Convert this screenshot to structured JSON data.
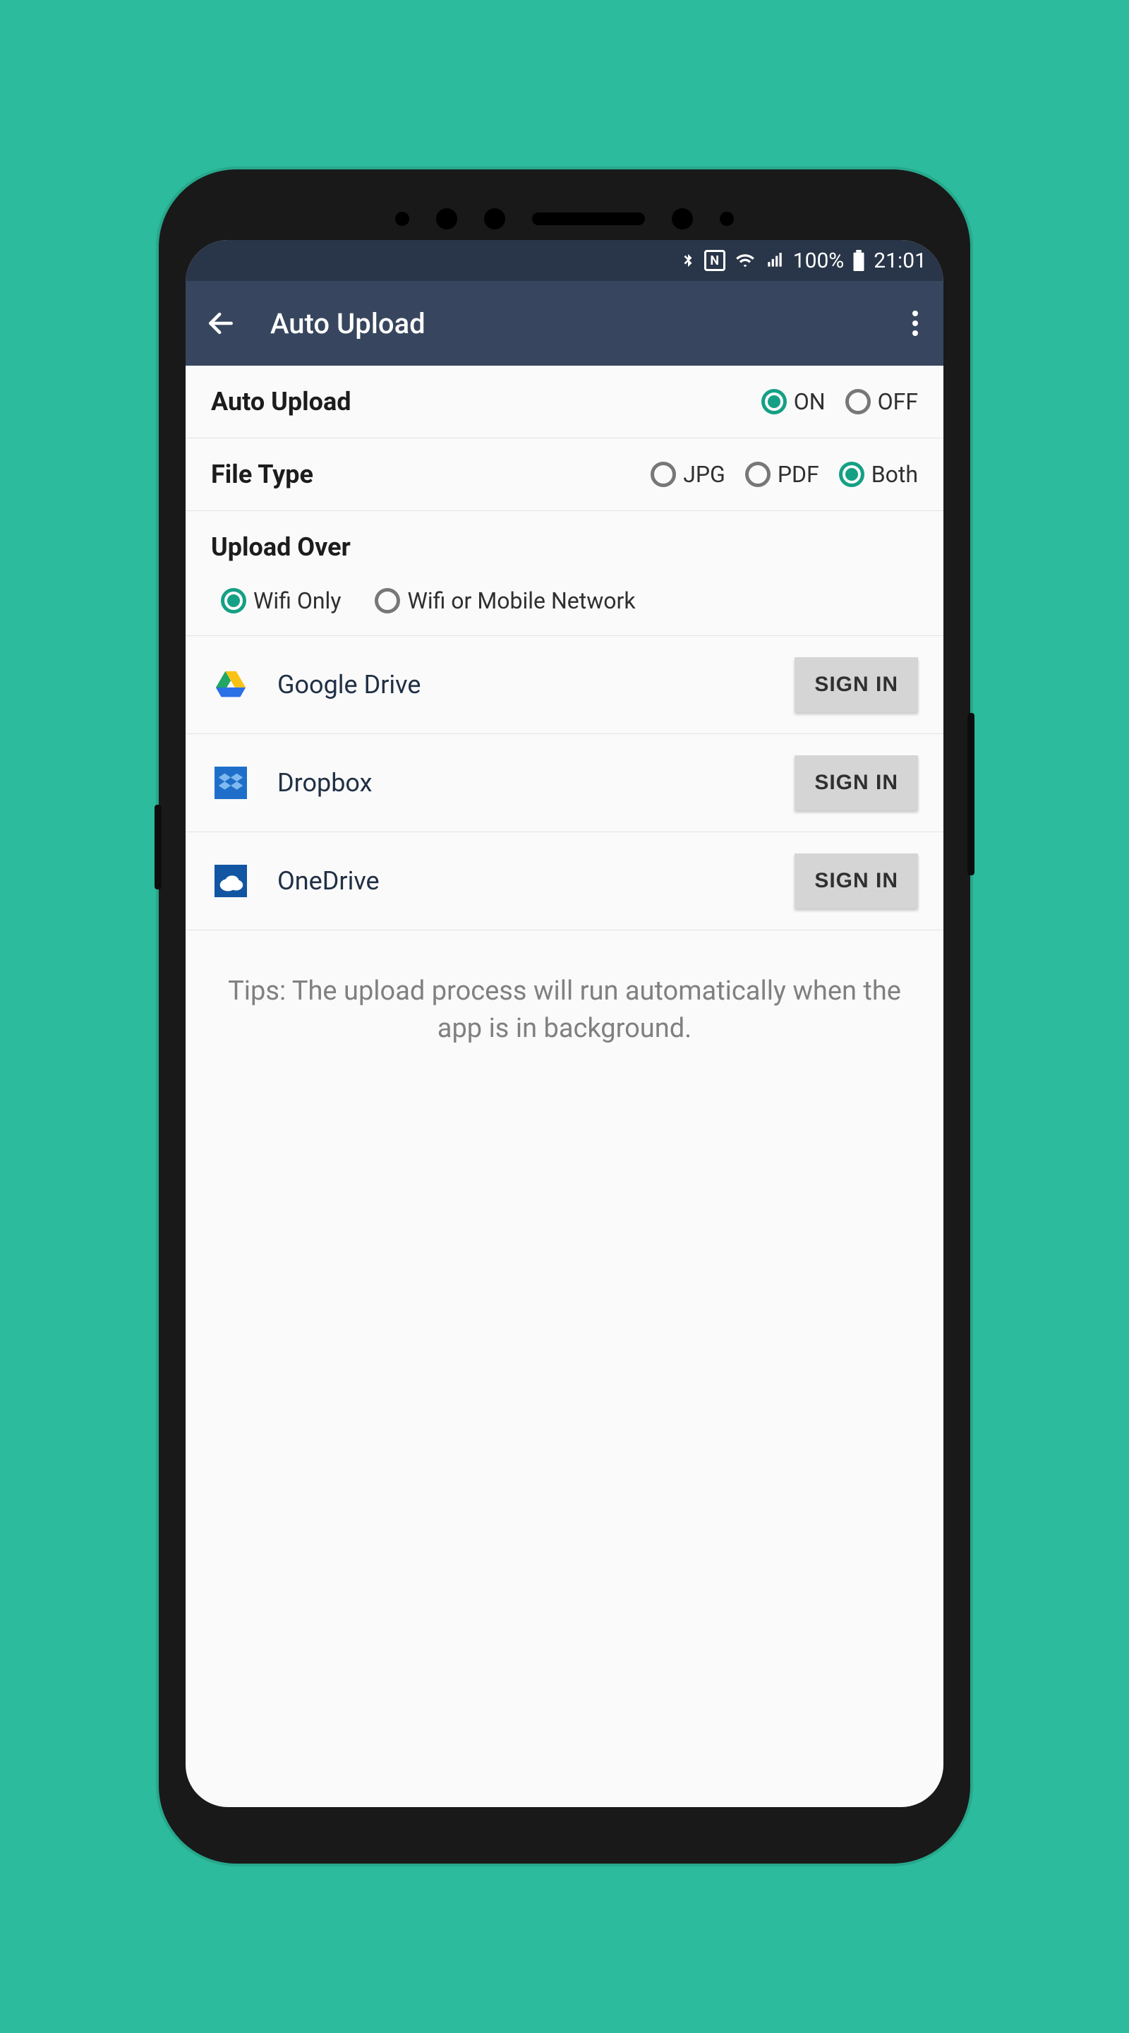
{
  "statusbar": {
    "battery_pct": "100%",
    "time": "21:01"
  },
  "appbar": {
    "title": "Auto Upload"
  },
  "settings": {
    "auto_upload": {
      "label": "Auto Upload",
      "options": {
        "on": "ON",
        "off": "OFF"
      },
      "selected": "on"
    },
    "file_type": {
      "label": "File Type",
      "options": {
        "jpg": "JPG",
        "pdf": "PDF",
        "both": "Both"
      },
      "selected": "both"
    },
    "upload_over": {
      "label": "Upload Over",
      "options": {
        "wifi": "Wifi Only",
        "wifi_mobile": "Wifi or Mobile Network"
      },
      "selected": "wifi"
    }
  },
  "services": [
    {
      "key": "google_drive",
      "name": "Google Drive",
      "button": "SIGN IN"
    },
    {
      "key": "dropbox",
      "name": "Dropbox",
      "button": "SIGN IN"
    },
    {
      "key": "onedrive",
      "name": "OneDrive",
      "button": "SIGN IN"
    }
  ],
  "tips": "Tips: The upload process will run automatically when the app is in background."
}
